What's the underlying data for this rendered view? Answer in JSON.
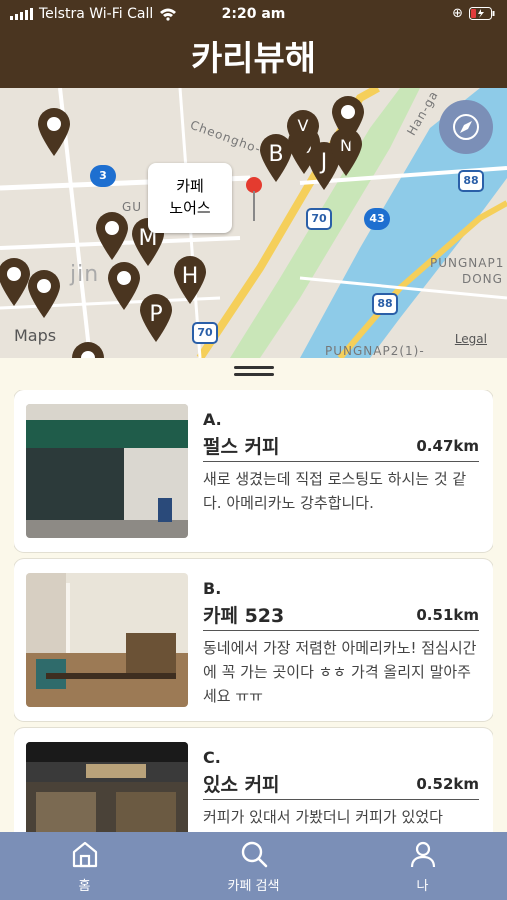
{
  "status": {
    "carrier": "Telstra Wi-Fi Call",
    "time": "2:20 am"
  },
  "header": {
    "title": "카리뷰해"
  },
  "map": {
    "callout": [
      "카페",
      "노어스"
    ],
    "labels": {
      "legal": "Legal",
      "maps": "Maps",
      "han": "Han-ga",
      "dong1": "PUNGNAP1",
      "dong2": "DONG",
      "pungnap2": "PUNGNAP2(1)-",
      "cheongho": "Cheongho-da",
      "jin": "jin",
      "gu": "GU"
    },
    "routes": [
      "3",
      "70",
      "43",
      "88",
      "88",
      "70"
    ],
    "pins": [
      "B",
      "G",
      "V",
      "J",
      "N",
      "M",
      "H",
      "P",
      ""
    ]
  },
  "cafes": [
    {
      "letter": "A.",
      "name": "펄스 커피",
      "distance": "0.47km",
      "desc": "새로 생겼는데 직접 로스팅도 하시는 것 같다. 아메리카노 강추합니다."
    },
    {
      "letter": "B.",
      "name": "카페 523",
      "distance": "0.51km",
      "desc": "동네에서 가장 저렴한 아메리카노! 점심시간에 꼭 가는 곳이다 ㅎㅎ 가격 올리지 말아주세요 ㅠㅠ"
    },
    {
      "letter": "C.",
      "name": "있소 커피",
      "distance": "0.52km",
      "desc": "커피가 있대서 가봤더니 커피가 있었다"
    }
  ],
  "tabs": [
    {
      "label": "홈"
    },
    {
      "label": "카페 검색"
    },
    {
      "label": "나"
    }
  ]
}
